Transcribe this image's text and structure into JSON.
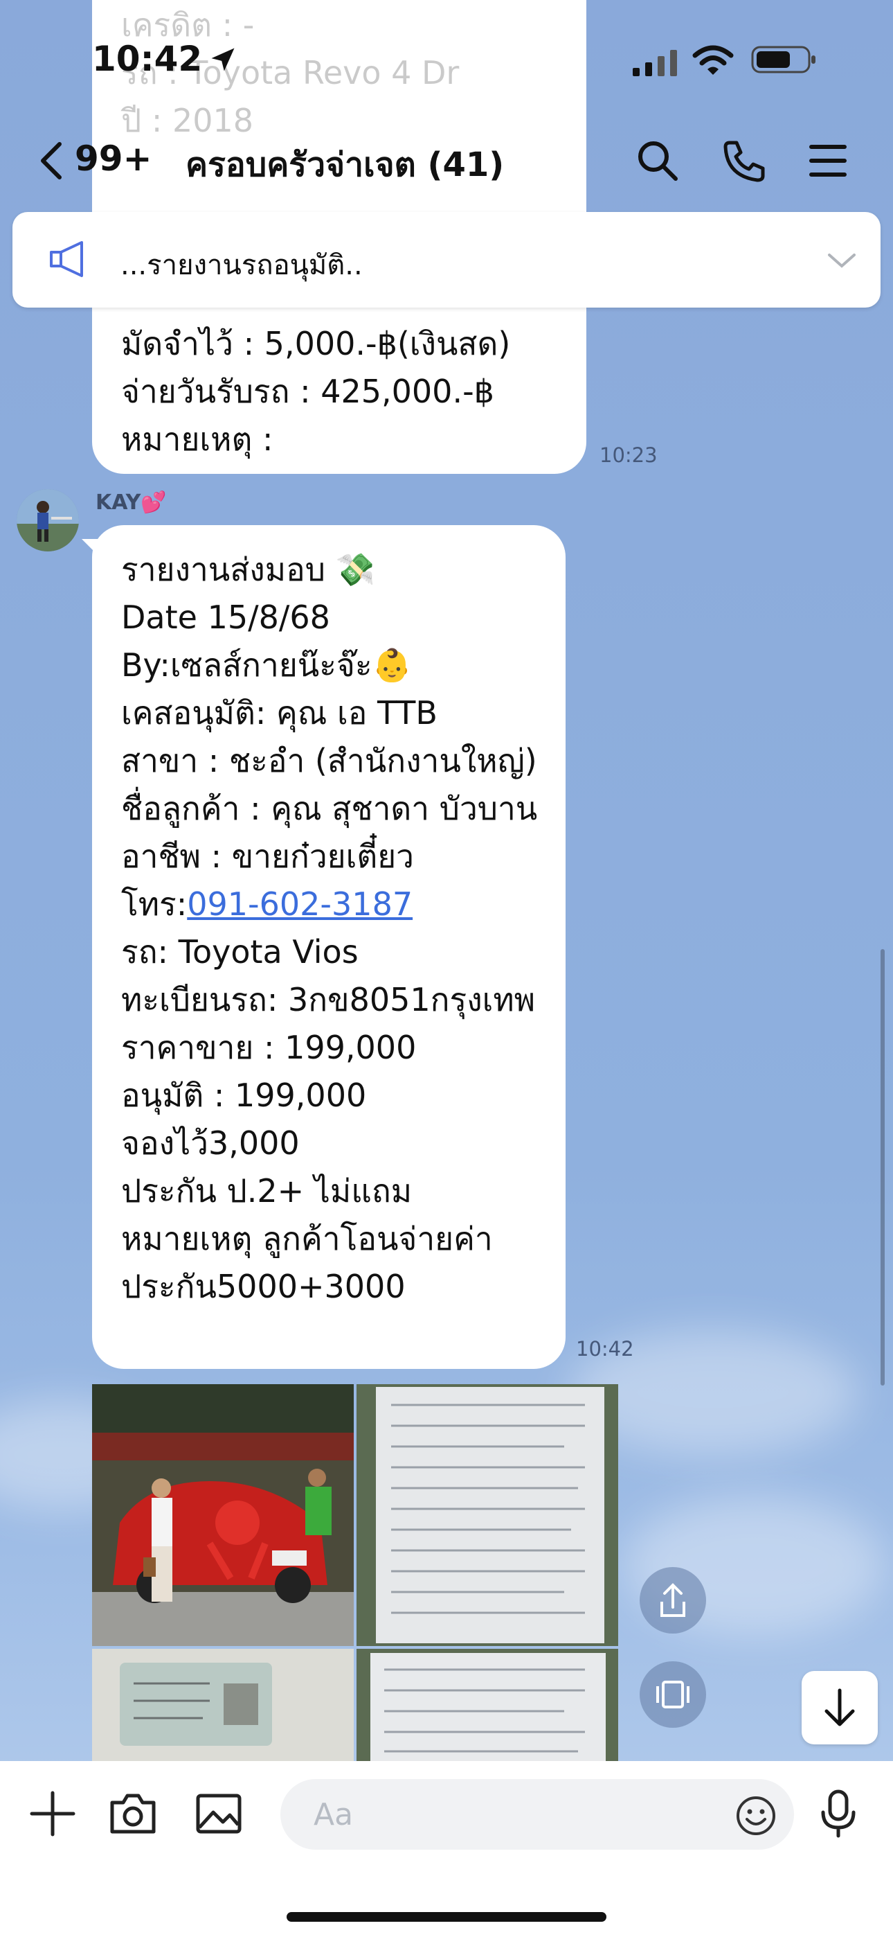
{
  "status_bar": {
    "time": "10:42"
  },
  "header": {
    "unread_count": "99+",
    "title": "ครอบครัวจ่าเจต (41)"
  },
  "announcement": {
    "text": "...รายงานรถอนุมัติ.."
  },
  "prev_message": {
    "faded_lines": [
      "เครดิต : -",
      "รถ : Toyota Revo 4 Dr",
      "ปี : 2018"
    ],
    "lines": [
      "มัดจำไว้ : 5,000.-฿(เงินสด)",
      "จ่ายวันรับรถ : 425,000.-฿",
      "หมายเหตุ :"
    ],
    "time": "10:23"
  },
  "message": {
    "sender": "KAY💕",
    "time": "10:42",
    "lines": [
      "รายงานส่งมอบ 💸",
      "Date 15/8/68",
      "By:เซลส์กายน๊ะจ๊ะ👶",
      "เคสอนุมัติ: คุณ เอ TTB",
      "สาขา : ชะอำ (สำนักงานใหญ่)",
      "ชื่อลูกค้า : คุณ สุชาดา บัวบาน",
      "อาชีพ : ขายก๋วยเตี๋ยว"
    ],
    "phone_prefix": "โทร:",
    "phone": "091-602-3187",
    "lines2": [
      "รถ:  Toyota Vios",
      "ทะเบียนรถ: 3กข8051กรุงเทพ",
      "ราคาขาย : 199,000",
      "อนุมัติ : 199,000",
      "จองไว้3,000",
      "ประกัน ป.2+ ไม่แถม",
      "หมายเหตุ ลูกค้าโอนจ่ายค่า",
      "ประกัน5000+3000"
    ]
  },
  "composer": {
    "placeholder": "Aa"
  },
  "icons": {
    "back": "chevron-left-icon",
    "search": "search-icon",
    "call": "phone-icon",
    "menu": "menu-icon",
    "announce": "megaphone-icon",
    "add": "plus-icon",
    "camera": "camera-icon",
    "gallery": "image-icon",
    "emoji": "smiley-icon",
    "mic": "microphone-icon",
    "share": "share-icon",
    "scroll_down": "arrow-down-icon"
  },
  "colors": {
    "link": "#3b6ddc",
    "background": "#8eaedc",
    "bubble": "#ffffff"
  }
}
